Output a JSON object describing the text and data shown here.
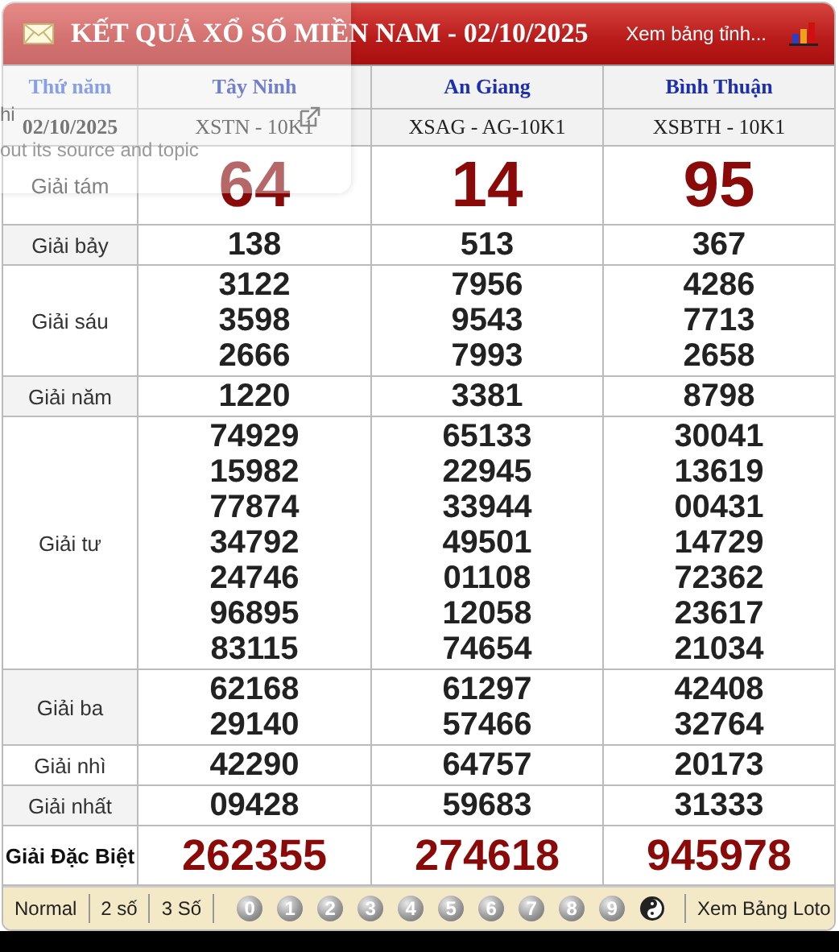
{
  "header": {
    "title": "KẾT QUẢ XỔ SỐ MIỀN NAM - 02/10/2025",
    "link": "Xem bảng tỉnh..."
  },
  "table": {
    "weekday": "Thứ năm",
    "date": "02/10/2025",
    "provinces": [
      {
        "name": "Tây Ninh",
        "code": "XSTN - 10K1"
      },
      {
        "name": "An Giang",
        "code": "XSAG - AG-10K1"
      },
      {
        "name": "Bình Thuận",
        "code": "XSBTH - 10K1"
      }
    ],
    "prizes": [
      {
        "label": "Giải tám",
        "kind": "big",
        "results": [
          [
            "64"
          ],
          [
            "14"
          ],
          [
            "95"
          ]
        ]
      },
      {
        "label": "Giải bảy",
        "kind": "normal",
        "results": [
          [
            "138"
          ],
          [
            "513"
          ],
          [
            "367"
          ]
        ]
      },
      {
        "label": "Giải sáu",
        "kind": "normal",
        "results": [
          [
            "3122",
            "3598",
            "2666"
          ],
          [
            "7956",
            "9543",
            "7993"
          ],
          [
            "4286",
            "7713",
            "2658"
          ]
        ]
      },
      {
        "label": "Giải năm",
        "kind": "normal",
        "results": [
          [
            "1220"
          ],
          [
            "3381"
          ],
          [
            "8798"
          ]
        ]
      },
      {
        "label": "Giải tư",
        "kind": "normal",
        "results": [
          [
            "74929",
            "15982",
            "77874",
            "34792",
            "24746",
            "96895",
            "83115"
          ],
          [
            "65133",
            "22945",
            "33944",
            "49501",
            "01108",
            "12058",
            "74654"
          ],
          [
            "30041",
            "13619",
            "00431",
            "14729",
            "72362",
            "23617",
            "21034"
          ]
        ]
      },
      {
        "label": "Giải ba",
        "kind": "normal",
        "results": [
          [
            "62168",
            "29140"
          ],
          [
            "61297",
            "57466"
          ],
          [
            "42408",
            "32764"
          ]
        ]
      },
      {
        "label": "Giải nhì",
        "kind": "normal",
        "results": [
          [
            "42290"
          ],
          [
            "64757"
          ],
          [
            "20173"
          ]
        ]
      },
      {
        "label": "Giải nhất",
        "kind": "normal",
        "results": [
          [
            "09428"
          ],
          [
            "59683"
          ],
          [
            "31333"
          ]
        ]
      },
      {
        "label": "Giải Đặc Biệt",
        "kind": "special",
        "results": [
          [
            "262355"
          ],
          [
            "274618"
          ],
          [
            "945978"
          ]
        ]
      }
    ]
  },
  "toolbar": {
    "modes": [
      "Normal",
      "2 số",
      "3 Số"
    ],
    "digits": [
      "0",
      "1",
      "2",
      "3",
      "4",
      "5",
      "6",
      "7",
      "8",
      "9"
    ],
    "link": "Xem Bảng Loto"
  },
  "overlay": {
    "lines": [
      "hi",
      "out its source and topic"
    ]
  }
}
